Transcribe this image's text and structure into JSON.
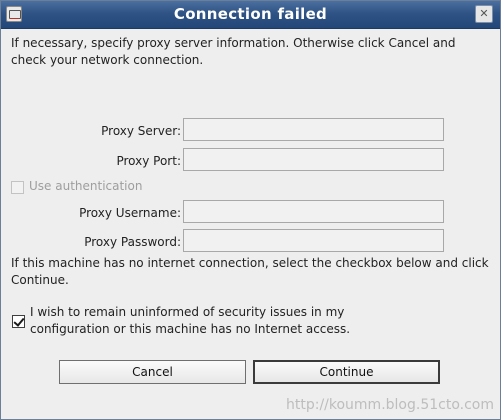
{
  "window": {
    "title": "Connection failed",
    "close_glyph": "✕"
  },
  "intro_text": "If necessary, specify proxy server information. Otherwise click Cancel and check your network connection.",
  "fields": {
    "proxy_server": {
      "label": "Proxy Server:",
      "value": ""
    },
    "proxy_port": {
      "label": "Proxy Port:",
      "value": ""
    },
    "use_auth": {
      "label": "Use  authentication",
      "checked": false
    },
    "proxy_username": {
      "label": "Proxy Username:",
      "value": ""
    },
    "proxy_password": {
      "label": "Proxy Password:",
      "value": ""
    }
  },
  "no_internet_text": "If this machine has no internet connection, select the checkbox below and click Continue.",
  "remain_uninformed": {
    "label": "I wish to remain uninformed of security issues in my configuration or this machine has no Internet access.",
    "checked": true
  },
  "buttons": {
    "cancel": "Cancel",
    "continue": "Continue"
  },
  "watermark": "http://koumm.blog.51cto.com",
  "icons": {
    "app": "app-window-icon",
    "close": "close-icon",
    "cursor": "mouse-pointer-icon"
  }
}
